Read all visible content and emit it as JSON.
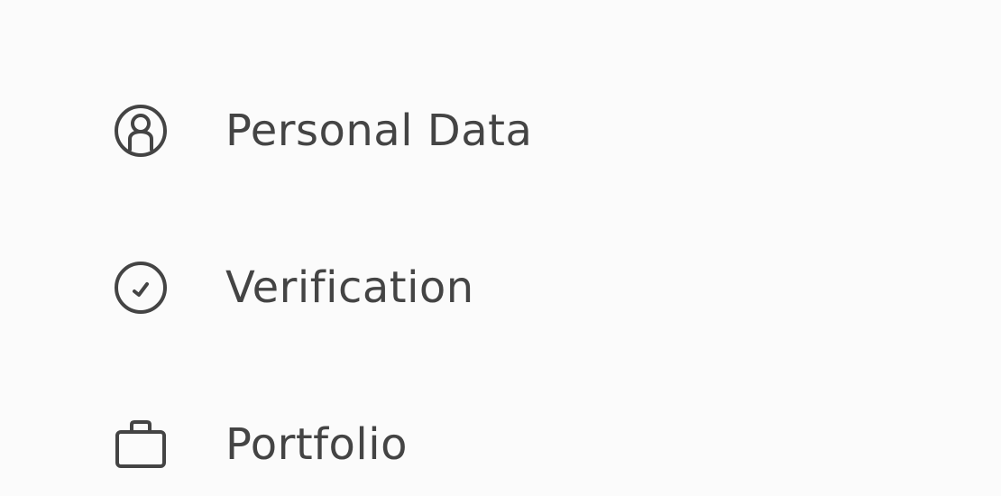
{
  "menu": {
    "items": [
      {
        "label": "Personal Data",
        "icon": "user-circle-icon"
      },
      {
        "label": "Verification",
        "icon": "check-circle-icon"
      },
      {
        "label": "Portfolio",
        "icon": "briefcase-icon"
      }
    ]
  },
  "colors": {
    "background": "#fbfbfb",
    "text": "#444444",
    "icon_stroke": "#444444"
  }
}
